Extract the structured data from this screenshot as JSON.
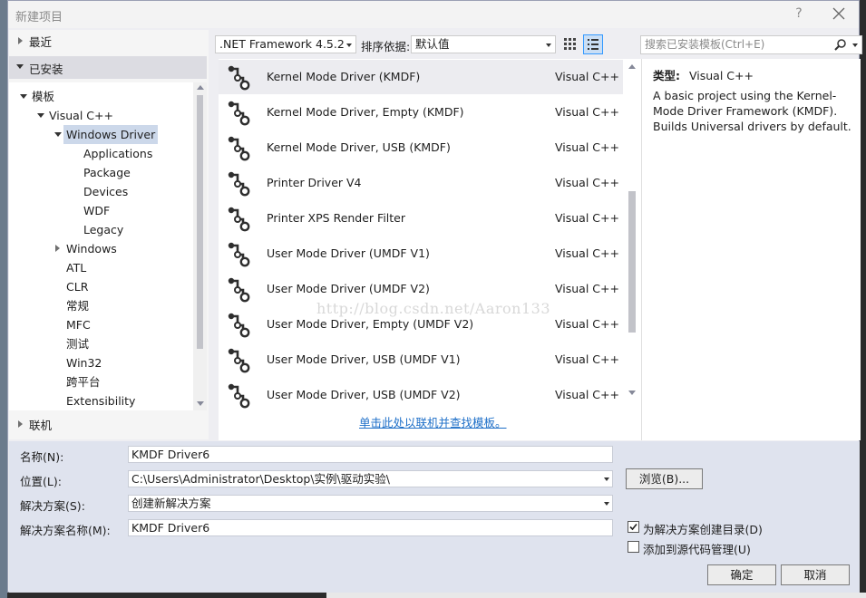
{
  "window": {
    "title": "新建项目",
    "help": "?"
  },
  "tree": {
    "recent": "最近",
    "installed": "已安装",
    "templates": "模板",
    "visual_cpp": "Visual C++",
    "windows_driver": "Windows Driver",
    "driver_children": [
      "Applications",
      "Package",
      "Devices",
      "WDF",
      "Legacy"
    ],
    "windows": "Windows",
    "others": [
      "ATL",
      "CLR",
      "常规",
      "MFC",
      "测试",
      "Win32",
      "跨平台",
      "Extensibility"
    ],
    "online": "联机"
  },
  "toolbar": {
    "framework": ".NET Framework 4.5.2",
    "sort_label": "排序依据:",
    "sort_value": "默认值",
    "search_placeholder": "搜索已安装模板(Ctrl+E)"
  },
  "templates": [
    {
      "name": "Kernel Mode Driver (KMDF)",
      "lang": "Visual C++",
      "selected": true
    },
    {
      "name": "Kernel Mode Driver, Empty (KMDF)",
      "lang": "Visual C++"
    },
    {
      "name": "Kernel Mode Driver, USB (KMDF)",
      "lang": "Visual C++"
    },
    {
      "name": "Printer Driver V4",
      "lang": "Visual C++"
    },
    {
      "name": "Printer XPS Render Filter",
      "lang": "Visual C++"
    },
    {
      "name": "User Mode Driver (UMDF V1)",
      "lang": "Visual C++"
    },
    {
      "name": "User Mode Driver (UMDF V2)",
      "lang": "Visual C++"
    },
    {
      "name": "User Mode Driver, Empty (UMDF V2)",
      "lang": "Visual C++"
    },
    {
      "name": "User Mode Driver, USB (UMDF V1)",
      "lang": "Visual C++"
    },
    {
      "name": "User Mode Driver, USB (UMDF V2)",
      "lang": "Visual C++"
    }
  ],
  "online_link": "单击此处以联机并查找模板。",
  "watermark": "http://blog.csdn.net/Aaron133",
  "description": {
    "type_label": "类型:",
    "type_value": "Visual C++",
    "text": "A basic project using the Kernel-Mode Driver Framework (KMDF). Builds Universal drivers by default."
  },
  "form": {
    "name_label": "名称(N):",
    "name_value": "KMDF Driver6",
    "location_label": "位置(L):",
    "location_value": "C:\\Users\\Administrator\\Desktop\\实例\\驱动实验\\",
    "solution_label": "解决方案(S):",
    "solution_value": "创建新解决方案",
    "solution_name_label": "解决方案名称(M):",
    "solution_name_value": "KMDF Driver6",
    "browse": "浏览(B)...",
    "create_dir": "为解决方案创建目录(D)",
    "create_dir_checked": true,
    "add_scc": "添加到源代码管理(U)",
    "add_scc_checked": false,
    "ok": "确定",
    "cancel": "取消"
  },
  "colors": {
    "accent": "#3399ff",
    "selection": "#ccd8ea",
    "link": "#1e6fc8"
  }
}
